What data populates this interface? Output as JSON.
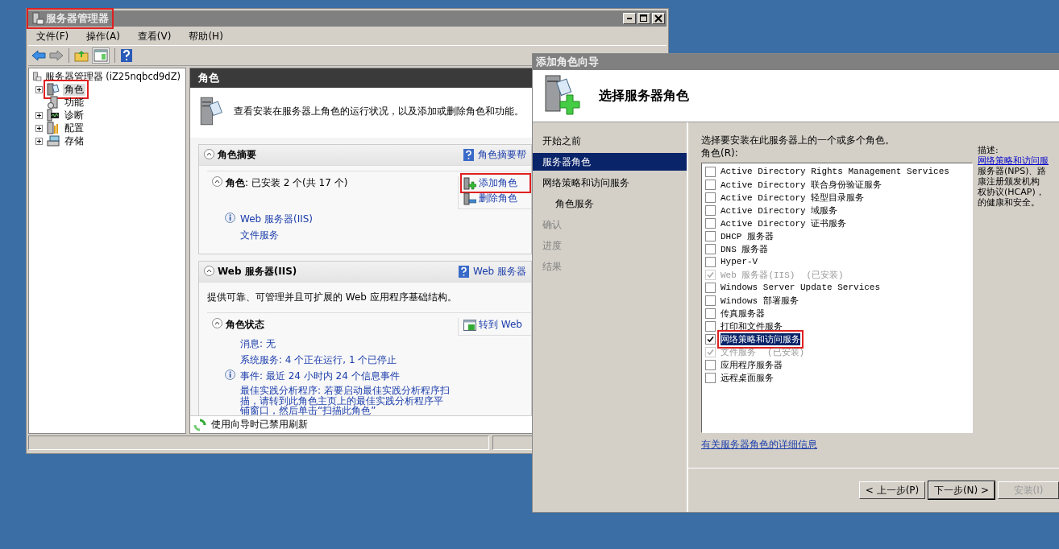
{
  "server_manager": {
    "title": "服务器管理器",
    "title_annotated": true,
    "menu": [
      "文件(F)",
      "操作(A)",
      "查看(V)",
      "帮助(H)"
    ],
    "tree": {
      "label": "服务器管理器 (iZ25nqbcd9dZ)",
      "children": [
        {
          "label": "角色",
          "kind": "roles",
          "expandable": true,
          "selected": true,
          "annotated": true
        },
        {
          "label": "功能",
          "kind": "features",
          "expandable": false,
          "selected": false,
          "annotated": false
        },
        {
          "label": "诊断",
          "kind": "diagnostics",
          "expandable": true,
          "selected": false,
          "annotated": false
        },
        {
          "label": "配置",
          "kind": "configuration",
          "expandable": true,
          "selected": false,
          "annotated": false
        },
        {
          "label": "存储",
          "kind": "storage",
          "expandable": true,
          "selected": false,
          "annotated": false
        }
      ]
    },
    "pane_header": "角色",
    "intro": "查看安装在服务器上角色的运行状况，以及添加或删除角色和功能。",
    "summary": {
      "title": "角色摘要",
      "help_link": "角色摘要帮",
      "subtitle": "**角色**: 已安装 2 个(共 17 个)",
      "installed": [
        "Web 服务器(IIS)",
        "文件服务"
      ],
      "actions": [
        {
          "label": "添加角色",
          "kind": "add",
          "annotated": true
        },
        {
          "label": "删除角色",
          "kind": "remove",
          "annotated": false
        }
      ]
    },
    "web_server": {
      "title": "Web 服务器(IIS)",
      "help_link": "Web 服务器",
      "description": "提供可靠、可管理并且可扩展的 Web 应用程序基础结构。",
      "status_title": "角色状态",
      "action": "转到 Web",
      "messages": [
        "消息: 无",
        "系统服务: 4 个正在运行, 1 个已停止"
      ],
      "event": "事件: 最近 24 小时内 24 个信息事件",
      "bpa": "最佳实践分析程序: 若要启动最佳实践分析程序扫描，请转到此角色主页上的最佳实践分析程序平铺窗口，然后单击“扫描此角色”"
    },
    "refresh_notice": "使用向导时已禁用刷新"
  },
  "wizard": {
    "title": "添加角色向导",
    "heading": "选择服务器角色",
    "steps": [
      {
        "label": "开始之前",
        "selected": false,
        "disabled": false
      },
      {
        "label": "服务器角色",
        "selected": true,
        "disabled": false
      },
      {
        "label": "网络策略和访问服务",
        "selected": false,
        "disabled": false,
        "children": [
          {
            "label": "角色服务",
            "selected": false,
            "disabled": false
          }
        ]
      },
      {
        "label": "确认",
        "selected": false,
        "disabled": true
      },
      {
        "label": "进度",
        "selected": false,
        "disabled": true
      },
      {
        "label": "结果",
        "selected": false,
        "disabled": true
      }
    ],
    "instruction": "选择要安装在此服务器上的一个或多个角色。",
    "list_label": "角色(R):",
    "roles": [
      {
        "label": "Active Directory Rights Management Services",
        "checked": false,
        "disabled": false,
        "selected": false,
        "annotated": false
      },
      {
        "label": "Active Directory 联合身份验证服务",
        "checked": false,
        "disabled": false,
        "selected": false,
        "annotated": false
      },
      {
        "label": "Active Directory 轻型目录服务",
        "checked": false,
        "disabled": false,
        "selected": false,
        "annotated": false
      },
      {
        "label": "Active Directory 域服务",
        "checked": false,
        "disabled": false,
        "selected": false,
        "annotated": false
      },
      {
        "label": "Active Directory 证书服务",
        "checked": false,
        "disabled": false,
        "selected": false,
        "annotated": false
      },
      {
        "label": "DHCP 服务器",
        "checked": false,
        "disabled": false,
        "selected": false,
        "annotated": false
      },
      {
        "label": "DNS 服务器",
        "checked": false,
        "disabled": false,
        "selected": false,
        "annotated": false
      },
      {
        "label": "Hyper-V",
        "checked": false,
        "disabled": false,
        "selected": false,
        "annotated": false
      },
      {
        "label": "Web 服务器(IIS)",
        "note": "(已安装)",
        "checked": true,
        "disabled": true,
        "selected": false,
        "annotated": false
      },
      {
        "label": "Windows Server Update Services",
        "checked": false,
        "disabled": false,
        "selected": false,
        "annotated": false
      },
      {
        "label": "Windows 部署服务",
        "checked": false,
        "disabled": false,
        "selected": false,
        "annotated": false
      },
      {
        "label": "传真服务器",
        "checked": false,
        "disabled": false,
        "selected": false,
        "annotated": false
      },
      {
        "label": "打印和文件服务",
        "checked": false,
        "disabled": false,
        "selected": false,
        "annotated": false
      },
      {
        "label": "网络策略和访问服务",
        "checked": true,
        "disabled": false,
        "selected": true,
        "annotated": true
      },
      {
        "label": "文件服务",
        "note": "(已安装)",
        "checked": true,
        "disabled": true,
        "selected": false,
        "annotated": false
      },
      {
        "label": "应用程序服务器",
        "checked": false,
        "disabled": false,
        "selected": false,
        "annotated": false
      },
      {
        "label": "远程桌面服务",
        "checked": false,
        "disabled": false,
        "selected": false,
        "annotated": false
      }
    ],
    "description_label": "描述:",
    "description_link": "网络策略和访问服",
    "description_lines": [
      "服务器(NPS)、路",
      "康注册颁发机构",
      "权协议(HCAP)，",
      "的健康和安全。"
    ],
    "more_link": "有关服务器角色的详细信息",
    "buttons": [
      {
        "label": "< 上一步(P)",
        "disabled": false,
        "default": false
      },
      {
        "label": "下一步(N) >",
        "disabled": false,
        "default": true
      },
      {
        "label": "安装(I)",
        "disabled": true,
        "default": false
      }
    ]
  }
}
